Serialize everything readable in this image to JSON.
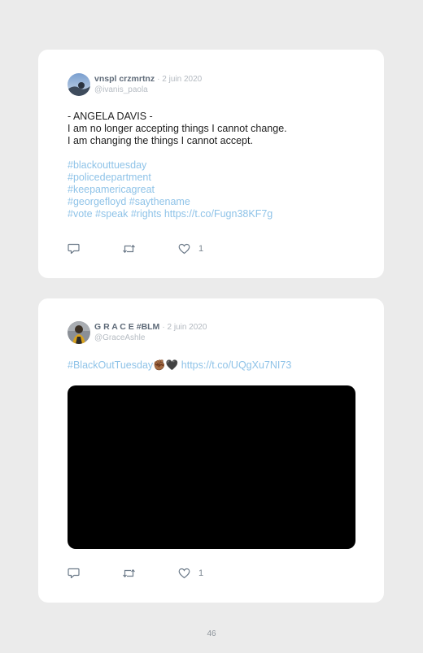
{
  "tweets": [
    {
      "name": "vnspl crzmrtnz",
      "date": "· 2 juin 2020",
      "handle": "@ivanis_paola",
      "lines": [
        "- ANGELA DAVIS -",
        "I am no longer accepting things I cannot change.",
        "I am changing the things I cannot accept."
      ],
      "hashtags": [
        "#blackouttuesday",
        "#policedepartment",
        "#keepamericagreat",
        "#georgefloyd #saythename",
        "#vote #speak #rights https://t.co/Fugn38KF7g"
      ],
      "like_count": "1"
    },
    {
      "name": "G R A C E #BLM",
      "date": "· 2 juin 2020",
      "handle": "@GraceAshle",
      "text_hashtag": "#BlackOutTuesday",
      "emoji": "✊🏾🖤",
      "link": "https://t.co/UQgXu7NI73",
      "like_count": "1"
    }
  ],
  "page_number": "46",
  "colors": {
    "background": "#ebebeb",
    "card": "#ffffff",
    "link": "#8fc3e8",
    "media": "#000000"
  },
  "icons": [
    "reply-icon",
    "retweet-icon",
    "heart-icon"
  ]
}
